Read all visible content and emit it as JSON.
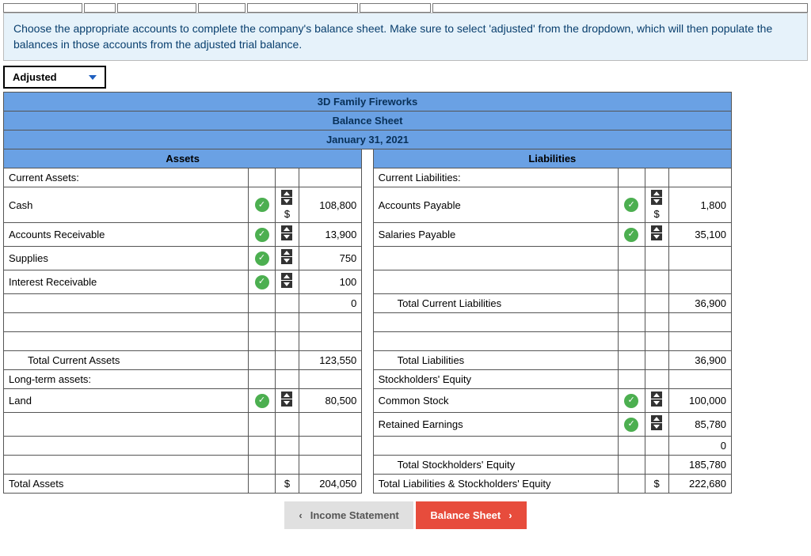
{
  "instructions": "Choose the appropriate accounts to complete the company's balance sheet. Make sure to select 'adjusted' from the dropdown, which will then populate the balances in those accounts from the adjusted trial balance.",
  "dropdown": {
    "label": "Adjusted"
  },
  "header": {
    "company": "3D Family Fireworks",
    "title": "Balance Sheet",
    "date": "January 31, 2021"
  },
  "sections": {
    "assets": "Assets",
    "liabilities": "Liabilities"
  },
  "assets": {
    "current_label": "Current Assets:",
    "cash": {
      "label": "Cash",
      "value": "108,800"
    },
    "ar": {
      "label": "Accounts Receivable",
      "value": "13,900"
    },
    "supplies": {
      "label": "Supplies",
      "value": "750"
    },
    "intrec": {
      "label": "Interest Receivable",
      "value": "100"
    },
    "zero": "0",
    "total_current": {
      "label": "Total Current Assets",
      "value": "123,550"
    },
    "longterm_label": "Long-term assets:",
    "land": {
      "label": "Land",
      "value": "80,500"
    },
    "total": {
      "label": "Total Assets",
      "value": "204,050"
    }
  },
  "liab": {
    "current_label": "Current Liabilities:",
    "ap": {
      "label": "Accounts Payable",
      "value": "1,800"
    },
    "sp": {
      "label": "Salaries Payable",
      "value": "35,100"
    },
    "total_current": {
      "label": "Total Current Liabilities",
      "value": "36,900"
    },
    "total": {
      "label": "Total Liabilities",
      "value": "36,900"
    },
    "se_label": "Stockholders' Equity",
    "cs": {
      "label": "Common Stock",
      "value": "100,000"
    },
    "re": {
      "label": "Retained Earnings",
      "value": "85,780"
    },
    "zero": "0",
    "tse": {
      "label": "Total Stockholders' Equity",
      "value": "185,780"
    },
    "tlse": {
      "label": "Total Liabilities & Stockholders' Equity",
      "value": "222,680"
    }
  },
  "dollar": "$",
  "nav": {
    "prev": "Income Statement",
    "current": "Balance Sheet"
  }
}
